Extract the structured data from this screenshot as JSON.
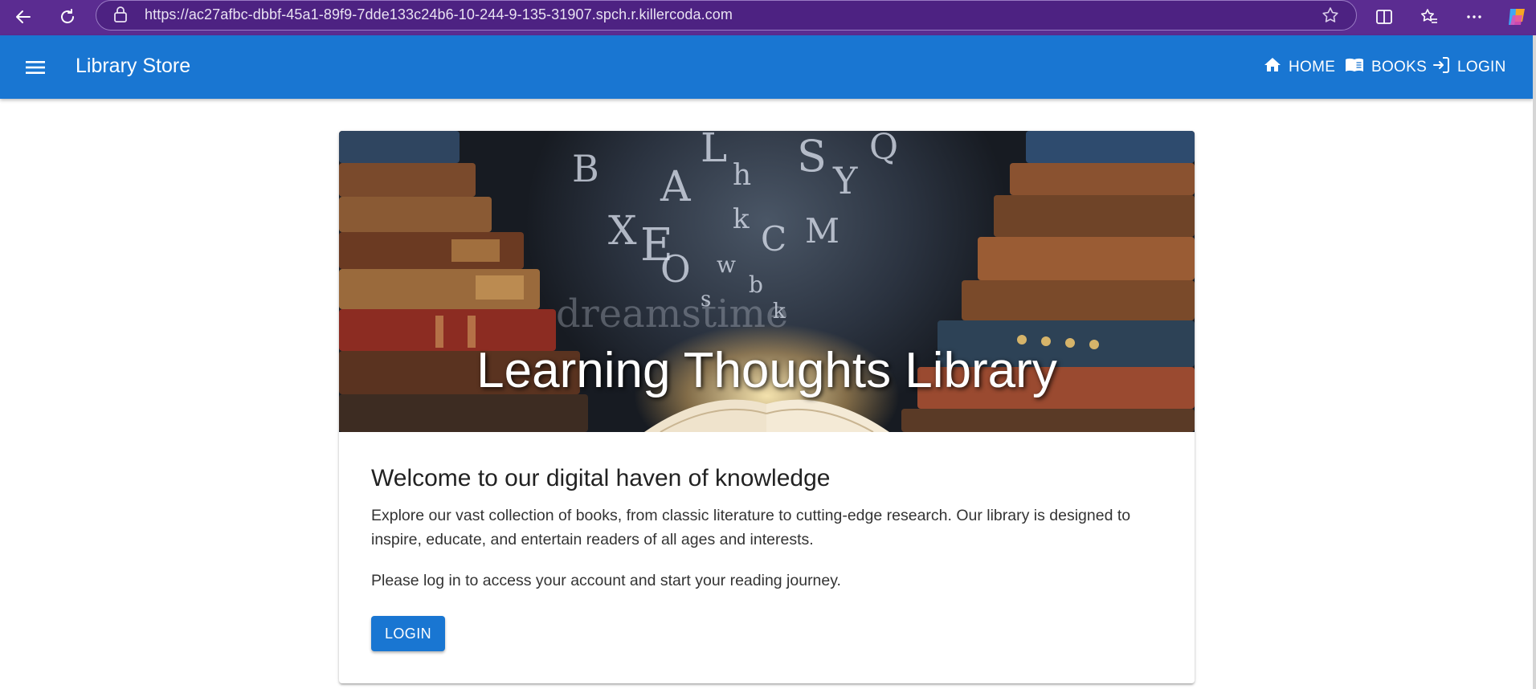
{
  "browser": {
    "url": "https://ac27afbc-dbbf-45a1-89f9-7dde133c24b6-10-244-9-135-31907.spch.r.killercoda.com",
    "icons": [
      "back-arrow-icon",
      "refresh-icon",
      "lock-icon",
      "star-icon",
      "split-screen-icon",
      "favorites-icon",
      "more-icon",
      "copilot-icon"
    ]
  },
  "app_bar": {
    "title": "Library Store",
    "nav": [
      {
        "label": "HOME",
        "icon": "home-icon"
      },
      {
        "label": "BOOKS",
        "icon": "book-icon"
      },
      {
        "label": "LOGIN",
        "icon": "login-icon"
      }
    ],
    "color": "#1976d2"
  },
  "hero": {
    "title": "Learning Thoughts Library",
    "watermark": "dreamstime"
  },
  "content": {
    "heading": "Welcome to our digital haven of knowledge",
    "paragraph1": "Explore our vast collection of books, from classic literature to cutting-edge research. Our library is designed to inspire, educate, and entertain readers of all ages and interests.",
    "paragraph2": "Please log in to access your account and start your reading journey.",
    "login_button": "LOGIN"
  }
}
